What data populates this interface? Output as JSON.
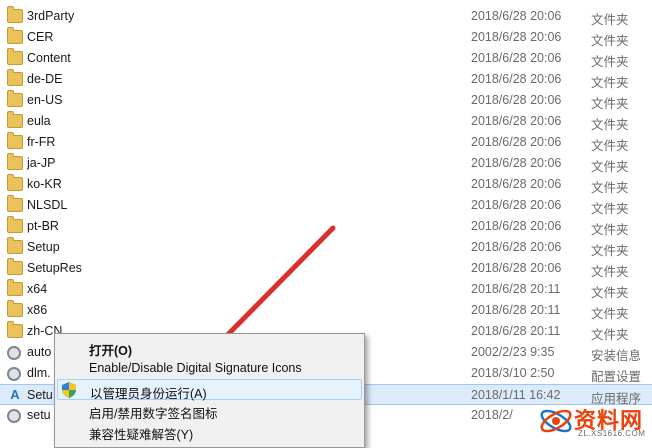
{
  "files": [
    {
      "name": "3rdParty",
      "date": "2018/6/28 20:06",
      "type": "文件夹",
      "icon": "folder-icon"
    },
    {
      "name": "CER",
      "date": "2018/6/28 20:06",
      "type": "文件夹",
      "icon": "folder-icon"
    },
    {
      "name": "Content",
      "date": "2018/6/28 20:06",
      "type": "文件夹",
      "icon": "folder-icon"
    },
    {
      "name": "de-DE",
      "date": "2018/6/28 20:06",
      "type": "文件夹",
      "icon": "folder-icon"
    },
    {
      "name": "en-US",
      "date": "2018/6/28 20:06",
      "type": "文件夹",
      "icon": "folder-icon"
    },
    {
      "name": "eula",
      "date": "2018/6/28 20:06",
      "type": "文件夹",
      "icon": "folder-icon"
    },
    {
      "name": "fr-FR",
      "date": "2018/6/28 20:06",
      "type": "文件夹",
      "icon": "folder-icon"
    },
    {
      "name": "ja-JP",
      "date": "2018/6/28 20:06",
      "type": "文件夹",
      "icon": "folder-icon"
    },
    {
      "name": "ko-KR",
      "date": "2018/6/28 20:06",
      "type": "文件夹",
      "icon": "folder-icon"
    },
    {
      "name": "NLSDL",
      "date": "2018/6/28 20:06",
      "type": "文件夹",
      "icon": "folder-icon"
    },
    {
      "name": "pt-BR",
      "date": "2018/6/28 20:06",
      "type": "文件夹",
      "icon": "folder-icon"
    },
    {
      "name": "Setup",
      "date": "2018/6/28 20:06",
      "type": "文件夹",
      "icon": "folder-icon"
    },
    {
      "name": "SetupRes",
      "date": "2018/6/28 20:06",
      "type": "文件夹",
      "icon": "folder-icon"
    },
    {
      "name": "x64",
      "date": "2018/6/28 20:11",
      "type": "文件夹",
      "icon": "folder-icon"
    },
    {
      "name": "x86",
      "date": "2018/6/28 20:11",
      "type": "文件夹",
      "icon": "folder-icon"
    },
    {
      "name": "zh-CN",
      "date": "2018/6/28 20:11",
      "type": "文件夹",
      "icon": "folder-icon"
    },
    {
      "name": "auto",
      "date": "2002/2/23 9:35",
      "type": "安装信息",
      "icon": "settings-file-icon"
    },
    {
      "name": "dlm.",
      "date": "2018/3/10 2:50",
      "type": "配置设置",
      "icon": "settings-file-icon"
    },
    {
      "name": "Setu",
      "date": "2018/1/11 16:42",
      "type": "应用程序",
      "icon": "autodesk-app-icon",
      "selected": true
    },
    {
      "name": "setu",
      "date": "2018/2/",
      "type": "",
      "icon": "settings-file-icon"
    }
  ],
  "context_menu": {
    "items": [
      {
        "label": "打开(O)",
        "bold": true
      },
      {
        "label": "Enable/Disable Digital Signature Icons"
      },
      {
        "label": "以管理员身份运行(A)",
        "highlighted": true,
        "icon": "uac-shield-icon"
      },
      {
        "label": "启用/禁用数字签名图标"
      },
      {
        "label": "兼容性疑难解答(Y)"
      }
    ]
  },
  "watermark": {
    "logo": "资料网",
    "sub": "ZL.XS1616.COM"
  },
  "colors": {
    "folder": "#e9c25c",
    "selection": "#dcebfc",
    "arrow": "#d9302c",
    "watermark": "#e8430c"
  }
}
